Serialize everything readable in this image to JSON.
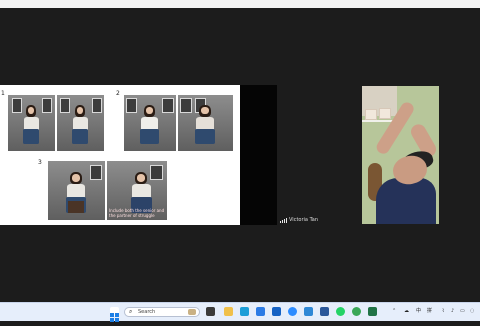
{
  "meeting": {
    "participant_name": "Victoria Tan",
    "slide": {
      "group_numbers": [
        "1",
        "2",
        "3"
      ],
      "caption": "Include both the senior and the partner of struggle"
    }
  },
  "taskbar": {
    "search_label": "Search",
    "tray": {
      "ime_mode": "中",
      "ime_layout": "拼"
    },
    "icons": [
      "windows-start-icon",
      "search-icon",
      "media-icon",
      "file-explorer-icon",
      "chrome-icon",
      "edge-icon",
      "store-icon",
      "outlook-icon",
      "zoom-icon",
      "todo-icon",
      "word-icon",
      "whatsapp-icon",
      "chrome-profile-icon",
      "excel-icon"
    ]
  }
}
